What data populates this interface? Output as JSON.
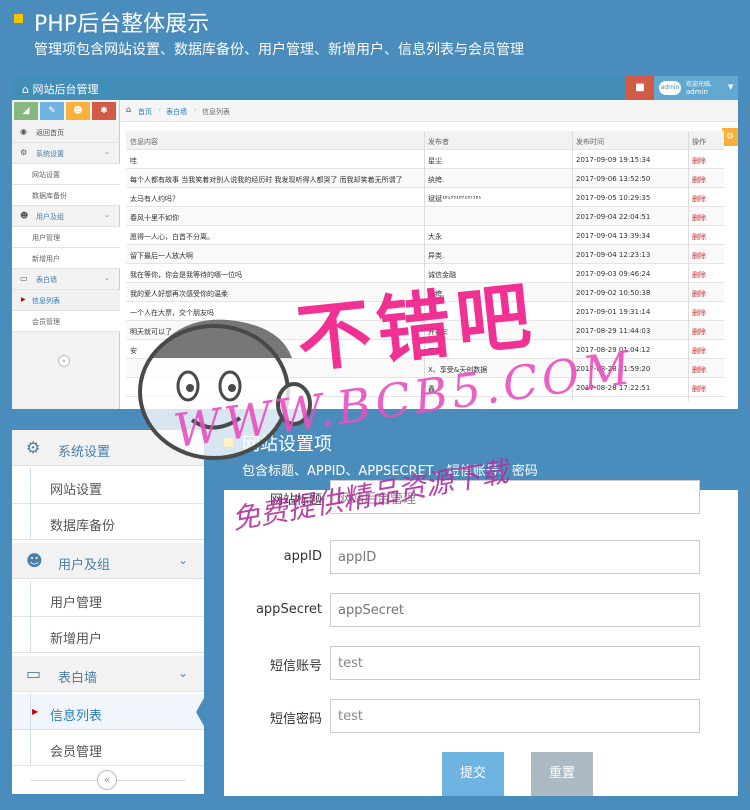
{
  "hero": {
    "title": "PHP后台整体展示",
    "subtitle": "管理项包含网站设置、数据库备份、用户管理、新增用户、信息列表与会员管理"
  },
  "panel1": {
    "brand": "网站后台管理",
    "user": {
      "welcome": "欢迎光临,",
      "name": "admin",
      "avatar": "admin"
    },
    "shortcuts": [
      {
        "icon": "signal-icon",
        "color": "#87b87f"
      },
      {
        "icon": "pencil-icon",
        "color": "#6fb3e0"
      },
      {
        "icon": "users-icon",
        "color": "#fbb03b"
      },
      {
        "icon": "cogs-icon",
        "color": "#d15b47"
      }
    ],
    "menu": {
      "home": "返回首页",
      "system": "系统设置",
      "site_settings": "网站设置",
      "db_backup": "数据库备份",
      "users_group": "用户及组",
      "user_mgmt": "用户管理",
      "add_user": "新增用户",
      "wall": "表白墙",
      "info_list": "信息列表",
      "member_mgmt": "会员管理"
    },
    "breadcrumb": [
      "首页",
      "表白墙",
      "信息列表"
    ],
    "table": {
      "headers": [
        "信息内容",
        "发布者",
        "发布时间",
        "操作"
      ],
      "rows": [
        [
          "哇",
          "星尘",
          "2017-09-09 19:15:34",
          "删除"
        ],
        [
          "每个人都有故事 当我笑着对别人说我的经历时 我发现听得人都哭了 而我却笑着无所谓了",
          "纨绔.",
          "2017-09-06 13:52:50",
          "删除"
        ],
        [
          "太马有人约吗？",
          "斌斌¹⁸¹³⁵¹⁸⁷¹⁸⁷¹⁸¹",
          "2017-09-05 10:29:35",
          "删除"
        ],
        [
          "春风十里不如你",
          "",
          "2017-09-04 22:04:51",
          "删除"
        ],
        [
          "愿得一人心，白首不分离。",
          "大永",
          "2017-09-04 13:39:34",
          "删除"
        ],
        [
          "留下最后一人放大啊",
          "异类.",
          "2017-09-04 12:23:13",
          "删除"
        ],
        [
          "我在等你，你会是我等待的哪一位吗",
          "诚信金融",
          "2017-09-03 09:46:24",
          "删除"
        ],
        [
          "我的爱人好想再次感受你的温柔",
          "纨绔.",
          "2017-09-02 10:50:38",
          "删除"
        ],
        [
          "一个人在大票，交个朋友吗",
          "",
          "2017-09-01 19:31:14",
          "删除"
        ],
        [
          "明天就可以了",
          "开花ミ",
          "2017-08-29 11:44:03",
          "删除"
        ],
        [
          "安",
          "三尝",
          "2017-08-29 01:04:12",
          "删除"
        ],
        [
          "",
          "X、享受&天创数据",
          "2017-08-28 21:59:20",
          "删除"
        ],
        [
          "",
          "鑫",
          "2017-08-28 17:22:51",
          "删除"
        ]
      ]
    }
  },
  "panel2": {
    "system": "系统设置",
    "site_settings": "网站设置",
    "db_backup": "数据库备份",
    "users_group": "用户及组",
    "user_mgmt": "用户管理",
    "add_user": "新增用户",
    "wall": "表白墙",
    "info_list": "信息列表",
    "member_mgmt": "会员管理"
  },
  "form_section": {
    "title": "网站设置项",
    "subtitle": "包含标题、APPID、APPSECRET、短信账号、密码",
    "fields": [
      {
        "label": "网站标题",
        "value": "网站后台管理"
      },
      {
        "label": "appID",
        "placeholder": "appID"
      },
      {
        "label": "appSecret",
        "placeholder": "appSecret"
      },
      {
        "label": "短信账号",
        "value": "test"
      },
      {
        "label": "短信密码",
        "value": "test"
      }
    ],
    "submit": "提交",
    "reset": "重置"
  },
  "watermark": {
    "big": "不错吧",
    "url": "WWW.BCB5.COM",
    "slogan": "免费提供精品资源下载"
  },
  "colors": {
    "background": "#4a8dbd",
    "accent_yellow": "#f5c400",
    "navbar": "#438eb9",
    "delete_red": "#c9302c",
    "watermark_pink": "#f0208a"
  }
}
